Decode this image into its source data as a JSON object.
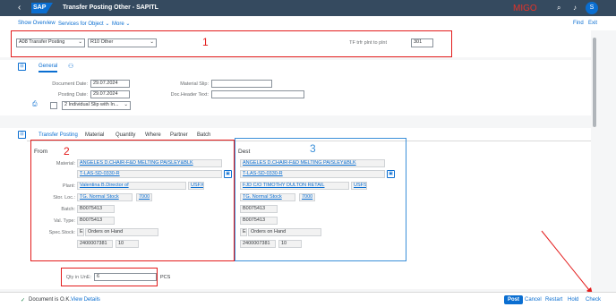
{
  "shell": {
    "back": "‹",
    "logo": "SAP",
    "title": "Transfer Posting Other - SAPITL",
    "tcode": "MIGO",
    "avatar": "S"
  },
  "subheader": {
    "show_overview": "Show Overview",
    "services": "Services for Object",
    "more": "More",
    "find": "Find",
    "exit": "Exit"
  },
  "top": {
    "action": "A08 Transfer Posting",
    "reference": "R10 Other",
    "tf_label": "TF trfr plnt to plnt",
    "mvt_type": "301",
    "annotation": "1"
  },
  "header_tabs": {
    "general": "General"
  },
  "general": {
    "doc_date_label": "Document Date:",
    "doc_date": "29.07.2024",
    "post_date_label": "Posting Date:",
    "post_date": "29.07.2024",
    "slip_option": "2 Individual Slip with In...",
    "mat_slip_label": "Material Slip:",
    "mat_slip": "",
    "doc_header_label": "Doc.Header Text:",
    "doc_header": ""
  },
  "item_tabs": [
    "Transfer Posting",
    "Material",
    "Quantity",
    "Where",
    "Partner",
    "Batch"
  ],
  "from": {
    "heading": "From",
    "annotation": "2",
    "material_label": "Material:",
    "material_desc": "ANGELES D.CHAIR-F&D MELTING PAISLEY&BLK",
    "material_no": "T-LAS-SD-0330-R",
    "plant_label": "Plant:",
    "plant_name": "Valentina B.Director of",
    "plant_code": "USFX",
    "sloc_label": "Stor. Loc.:",
    "sloc_name": "TG. Normal Stock",
    "sloc_code": "7000",
    "batch_label": "Batch:",
    "batch": "B0075413",
    "valtype_label": "Val. Type:",
    "valtype": "B0075413",
    "specstock_label": "Spec.Stock:",
    "specstock_code": "E",
    "specstock_name": "Orders on Hand",
    "so_number": "2400007381",
    "so_item": "10"
  },
  "dest": {
    "heading": "Dest",
    "annotation": "3",
    "material_desc": "ANGELES D.CHAIR-F&D MELTING PAISLEY&BLK",
    "material_no": "T-LAS-SD-0330-R",
    "plant_name": "FJD C/O TIMOTHY DULTON RETAIL",
    "plant_code": "USFS",
    "sloc_name": "TG. Normal Stock",
    "sloc_code": "7000",
    "batch": "B0075413",
    "valtype": "B0075413",
    "specstock_code": "E",
    "specstock_name": "Orders on Hand",
    "so_number": "2400007381",
    "so_item": "10"
  },
  "qty": {
    "label": "Qty in UnE:",
    "value": "6",
    "unit": "PCS"
  },
  "footer": {
    "status": "Document is O.K.",
    "view_details": "View Details",
    "post": "Post",
    "cancel": "Cancel",
    "restart": "Restart",
    "hold": "Hold",
    "check": "Check"
  },
  "colors": {
    "shell": "#354a5f",
    "brand": "#0a6ed1",
    "annotation_red": "#e31b1b",
    "annotation_blue": "#3a8fd9"
  }
}
